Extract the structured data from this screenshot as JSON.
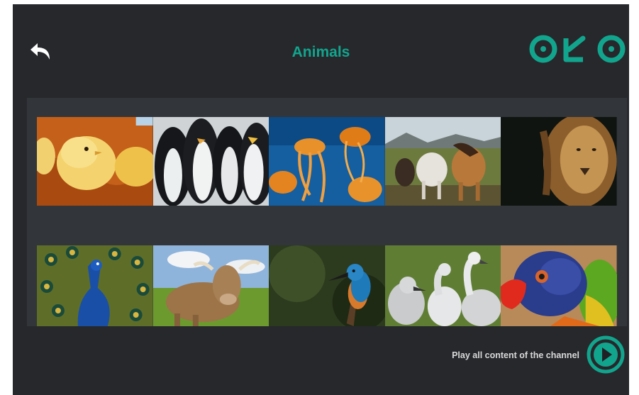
{
  "header": {
    "back_icon": "back-arrow-icon",
    "title": "Animals",
    "logo_text": "OKO",
    "accent_color": "#12a58e"
  },
  "grid": {
    "rows": [
      [
        {
          "name": "chicks",
          "icon": "chicks-image"
        },
        {
          "name": "penguins",
          "icon": "penguins-image"
        },
        {
          "name": "jellyfish",
          "icon": "jellyfish-image"
        },
        {
          "name": "horses",
          "icon": "horses-image"
        },
        {
          "name": "lion",
          "icon": "lion-image"
        }
      ],
      [
        {
          "name": "peacock",
          "icon": "peacock-image"
        },
        {
          "name": "cow",
          "icon": "cow-image"
        },
        {
          "name": "kingfisher",
          "icon": "kingfisher-image"
        },
        {
          "name": "cygnets",
          "icon": "cygnets-image"
        },
        {
          "name": "parrot",
          "icon": "parrot-image"
        }
      ]
    ]
  },
  "footer": {
    "play_label": "Play all content of the channel",
    "play_icon": "play-circle-icon"
  }
}
